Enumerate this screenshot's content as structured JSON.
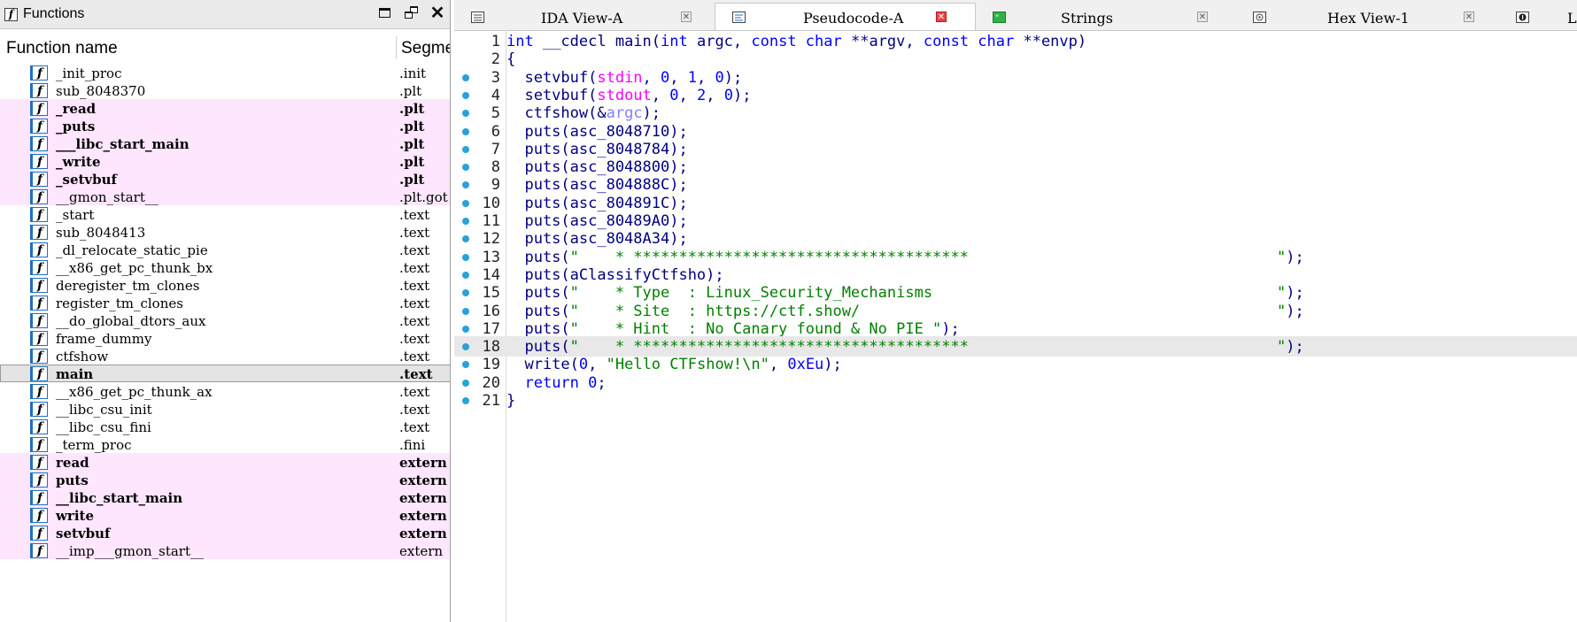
{
  "functions_panel": {
    "title": "Functions",
    "title_icon": "f",
    "columns": {
      "name": "Function name",
      "segment": "Segme"
    },
    "rows": [
      {
        "icon": "f",
        "name": "_init_proc",
        "segment": ".init",
        "style": "normal"
      },
      {
        "icon": "f",
        "name": "sub_8048370",
        "segment": ".plt",
        "style": "normal"
      },
      {
        "icon": "f",
        "name": "_read",
        "segment": ".plt",
        "style": "pink-bold"
      },
      {
        "icon": "f",
        "name": "_puts",
        "segment": ".plt",
        "style": "pink-bold"
      },
      {
        "icon": "f",
        "name": "___libc_start_main",
        "segment": ".plt",
        "style": "pink-bold"
      },
      {
        "icon": "f",
        "name": "_write",
        "segment": ".plt",
        "style": "pink-bold"
      },
      {
        "icon": "f",
        "name": "_setvbuf",
        "segment": ".plt",
        "style": "pink-bold"
      },
      {
        "icon": "f",
        "name": "__gmon_start__",
        "segment": ".plt.got",
        "style": "pink"
      },
      {
        "icon": "f",
        "name": "_start",
        "segment": ".text",
        "style": "normal"
      },
      {
        "icon": "f",
        "name": "sub_8048413",
        "segment": ".text",
        "style": "normal"
      },
      {
        "icon": "f",
        "name": "_dl_relocate_static_pie",
        "segment": ".text",
        "style": "normal"
      },
      {
        "icon": "f",
        "name": "__x86_get_pc_thunk_bx",
        "segment": ".text",
        "style": "normal"
      },
      {
        "icon": "f",
        "name": "deregister_tm_clones",
        "segment": ".text",
        "style": "normal"
      },
      {
        "icon": "f",
        "name": "register_tm_clones",
        "segment": ".text",
        "style": "normal"
      },
      {
        "icon": "f",
        "name": "__do_global_dtors_aux",
        "segment": ".text",
        "style": "normal"
      },
      {
        "icon": "f",
        "name": "frame_dummy",
        "segment": ".text",
        "style": "normal"
      },
      {
        "icon": "f",
        "name": "ctfshow",
        "segment": ".text",
        "style": "normal"
      },
      {
        "icon": "f",
        "name": "main",
        "segment": ".text",
        "style": "selected-bold"
      },
      {
        "icon": "f",
        "name": "__x86_get_pc_thunk_ax",
        "segment": ".text",
        "style": "normal"
      },
      {
        "icon": "f",
        "name": "__libc_csu_init",
        "segment": ".text",
        "style": "normal"
      },
      {
        "icon": "f",
        "name": "__libc_csu_fini",
        "segment": ".text",
        "style": "normal"
      },
      {
        "icon": "f",
        "name": "_term_proc",
        "segment": ".fini",
        "style": "normal"
      },
      {
        "icon": "f",
        "name": "read",
        "segment": "extern",
        "style": "pink-bold"
      },
      {
        "icon": "f",
        "name": "puts",
        "segment": "extern",
        "style": "pink-bold"
      },
      {
        "icon": "f",
        "name": "__libc_start_main",
        "segment": "extern",
        "style": "pink-bold"
      },
      {
        "icon": "f",
        "name": "write",
        "segment": "extern",
        "style": "pink-bold"
      },
      {
        "icon": "f",
        "name": "setvbuf",
        "segment": "extern",
        "style": "pink-bold"
      },
      {
        "icon": "f",
        "name": "__imp___gmon_start__",
        "segment": "extern",
        "style": "pink"
      }
    ]
  },
  "tabs": [
    {
      "label": "IDA View-A",
      "icon": "ida-view-icon",
      "active": false
    },
    {
      "label": "Pseudocode-A",
      "icon": "pseudocode-icon",
      "active": true
    },
    {
      "label": "Strings",
      "icon": "strings-icon",
      "active": false
    },
    {
      "label": "Hex View-1",
      "icon": "hex-view-icon",
      "active": false
    },
    {
      "label": "L",
      "icon": "info-icon",
      "active": false
    }
  ],
  "code": {
    "highlighted_line": 18,
    "lines": [
      {
        "n": "1",
        "dot": false,
        "tokens": [
          [
            "kw",
            "int"
          ],
          [
            "pl",
            " __cdecl main("
          ],
          [
            "kw",
            "int"
          ],
          [
            "pl",
            " argc, "
          ],
          [
            "kw",
            "const char"
          ],
          [
            "pl",
            " **argv, "
          ],
          [
            "kw",
            "const char"
          ],
          [
            "pl",
            " **envp)"
          ]
        ]
      },
      {
        "n": "2",
        "dot": false,
        "tokens": [
          [
            "pl",
            "{"
          ]
        ]
      },
      {
        "n": "3",
        "dot": true,
        "tokens": [
          [
            "pl",
            "  setvbuf("
          ],
          [
            "gv",
            "stdin"
          ],
          [
            "pl",
            ", "
          ],
          [
            "num",
            "0"
          ],
          [
            "pl",
            ", "
          ],
          [
            "num",
            "1"
          ],
          [
            "pl",
            ", "
          ],
          [
            "num",
            "0"
          ],
          [
            "pl",
            ");"
          ]
        ]
      },
      {
        "n": "4",
        "dot": true,
        "tokens": [
          [
            "pl",
            "  setvbuf("
          ],
          [
            "gv",
            "stdout"
          ],
          [
            "pl",
            ", "
          ],
          [
            "num",
            "0"
          ],
          [
            "pl",
            ", "
          ],
          [
            "num",
            "2"
          ],
          [
            "pl",
            ", "
          ],
          [
            "num",
            "0"
          ],
          [
            "pl",
            ");"
          ]
        ]
      },
      {
        "n": "5",
        "dot": true,
        "tokens": [
          [
            "pl",
            "  ctfshow(&"
          ],
          [
            "ar",
            "argc"
          ],
          [
            "pl",
            ");"
          ]
        ]
      },
      {
        "n": "6",
        "dot": true,
        "tokens": [
          [
            "pl",
            "  puts(asc_8048710);"
          ]
        ]
      },
      {
        "n": "7",
        "dot": true,
        "tokens": [
          [
            "pl",
            "  puts(asc_8048784);"
          ]
        ]
      },
      {
        "n": "8",
        "dot": true,
        "tokens": [
          [
            "pl",
            "  puts(asc_8048800);"
          ]
        ]
      },
      {
        "n": "9",
        "dot": true,
        "tokens": [
          [
            "pl",
            "  puts(asc_804888C);"
          ]
        ]
      },
      {
        "n": "10",
        "dot": true,
        "tokens": [
          [
            "pl",
            "  puts(asc_804891C);"
          ]
        ]
      },
      {
        "n": "11",
        "dot": true,
        "tokens": [
          [
            "pl",
            "  puts(asc_80489A0);"
          ]
        ]
      },
      {
        "n": "12",
        "dot": true,
        "tokens": [
          [
            "pl",
            "  puts(asc_8048A34);"
          ]
        ]
      },
      {
        "n": "13",
        "dot": true,
        "tokens": [
          [
            "pl",
            "  puts("
          ],
          [
            "str",
            "\"    * *************************************                                  \""
          ],
          [
            "pl",
            ");"
          ]
        ]
      },
      {
        "n": "14",
        "dot": true,
        "tokens": [
          [
            "pl",
            "  puts(aClassifyCtfsho);"
          ]
        ]
      },
      {
        "n": "15",
        "dot": true,
        "tokens": [
          [
            "pl",
            "  puts("
          ],
          [
            "str",
            "\"    * Type  : Linux_Security_Mechanisms                                      \""
          ],
          [
            "pl",
            ");"
          ]
        ]
      },
      {
        "n": "16",
        "dot": true,
        "tokens": [
          [
            "pl",
            "  puts("
          ],
          [
            "str",
            "\"    * Site  : https://ctf.show/                                              \""
          ],
          [
            "pl",
            ");"
          ]
        ]
      },
      {
        "n": "17",
        "dot": true,
        "tokens": [
          [
            "pl",
            "  puts("
          ],
          [
            "str",
            "\"    * Hint  : No Canary found & No PIE \""
          ],
          [
            "pl",
            ");"
          ]
        ]
      },
      {
        "n": "18",
        "dot": true,
        "tokens": [
          [
            "pl",
            "  puts("
          ],
          [
            "str",
            "\"    * *************************************                                  \""
          ],
          [
            "pl",
            ");"
          ]
        ]
      },
      {
        "n": "19",
        "dot": true,
        "tokens": [
          [
            "pl",
            "  write("
          ],
          [
            "num",
            "0"
          ],
          [
            "pl",
            ", "
          ],
          [
            "str",
            "\"Hello CTFshow!\\n\""
          ],
          [
            "pl",
            ", "
          ],
          [
            "num",
            "0xEu"
          ],
          [
            "pl",
            ");"
          ]
        ]
      },
      {
        "n": "20",
        "dot": true,
        "tokens": [
          [
            "pl",
            "  "
          ],
          [
            "kw",
            "return"
          ],
          [
            "pl",
            " "
          ],
          [
            "num",
            "0"
          ],
          [
            "pl",
            ";"
          ]
        ]
      },
      {
        "n": "21",
        "dot": true,
        "tokens": [
          [
            "pl",
            "}"
          ]
        ]
      }
    ]
  },
  "colors": {
    "keyword": "#0000ff",
    "global_var": "#ff00ff",
    "string": "#008000",
    "import_row_bg": "#ffe6ff",
    "breakpoint_dot": "#2aa2d8"
  }
}
